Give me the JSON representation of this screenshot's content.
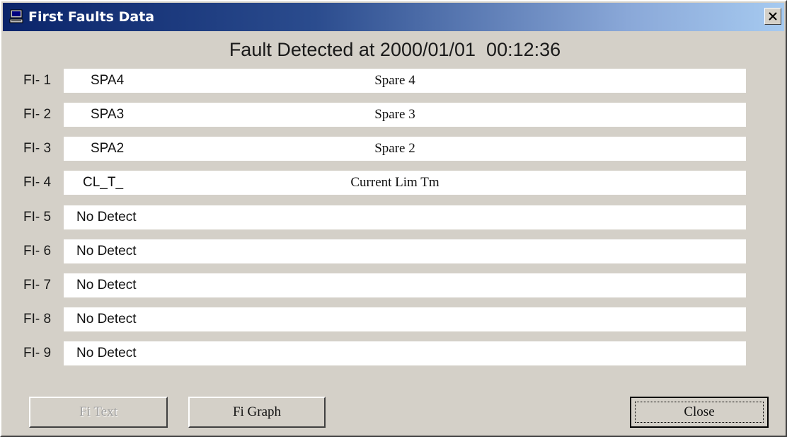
{
  "window": {
    "title": "First Faults Data",
    "title_icon": "computer-icon",
    "close_icon": "close-x-icon"
  },
  "headline": "Fault Detected at 2000/01/01  00:12:36",
  "faults": [
    {
      "label": "FI- 1",
      "code": "SPA4",
      "description": "Spare 4"
    },
    {
      "label": "FI- 2",
      "code": "SPA3",
      "description": "Spare 3"
    },
    {
      "label": "FI- 3",
      "code": "SPA2",
      "description": "Spare 2"
    },
    {
      "label": "FI- 4",
      "code": "CL_T_",
      "description": "Current Lim Tm"
    },
    {
      "label": "FI- 5",
      "code": "No Detect",
      "description": ""
    },
    {
      "label": "FI- 6",
      "code": "No Detect",
      "description": ""
    },
    {
      "label": "FI- 7",
      "code": "No Detect",
      "description": ""
    },
    {
      "label": "FI- 8",
      "code": "No Detect",
      "description": ""
    },
    {
      "label": "FI- 9",
      "code": "No Detect",
      "description": ""
    }
  ],
  "buttons": {
    "fi_text": "Fi Text",
    "fi_graph": "Fi Graph",
    "close": "Close"
  },
  "colors": {
    "title_gradient_start": "#0a246a",
    "title_gradient_end": "#a6caf0",
    "dialog_face": "#d4d0c8"
  }
}
